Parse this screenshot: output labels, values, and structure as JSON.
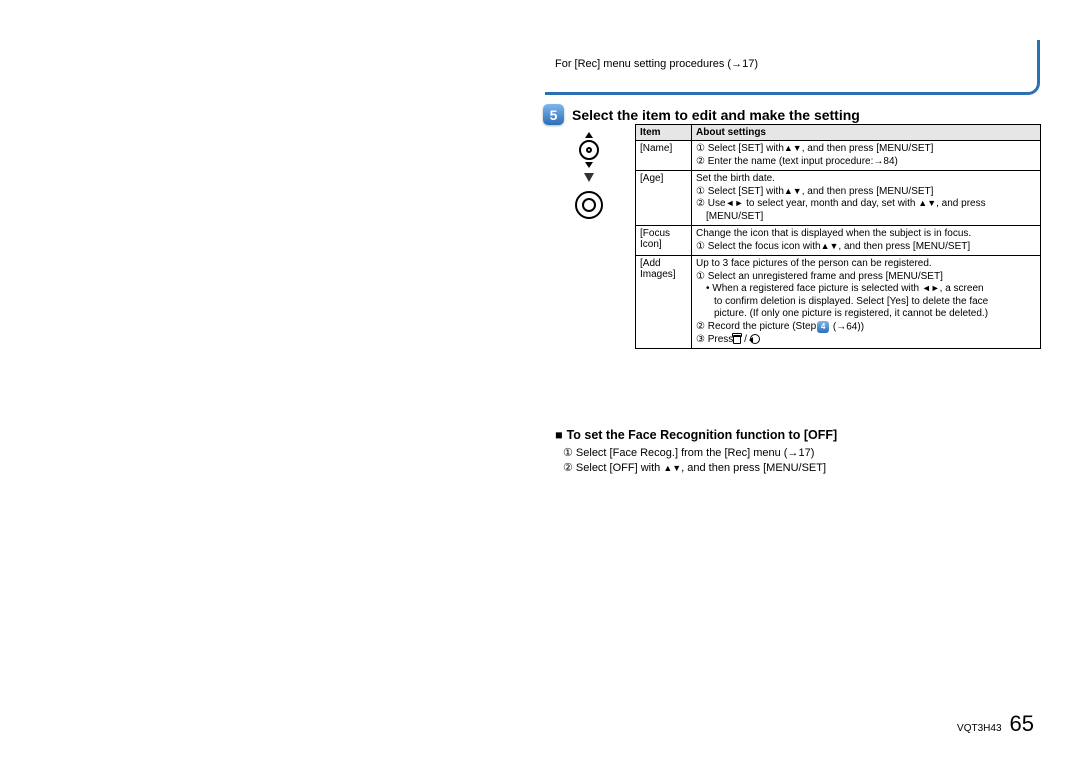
{
  "topNote": {
    "prefix": "For [Rec] menu setting procedures (",
    "ref": "→17",
    "suffix": ")"
  },
  "step": {
    "number": "5",
    "title": "Select the item to edit and make the setting"
  },
  "table": {
    "headers": {
      "item": "Item",
      "about": "About settings"
    },
    "rows": {
      "name": {
        "item": "[Name]",
        "l1a": "① Select [SET] with ",
        "l1b": ", and then press [MENU/SET]",
        "l2a": "② Enter the name (text input procedure: ",
        "l2ref": "→84",
        "l2b": ")"
      },
      "age": {
        "item": "[Age]",
        "l0": "Set the birth date.",
        "l1a": "① Select [SET] with ",
        "l1b": ", and then press [MENU/SET]",
        "l2a": "② Use ",
        "l2b": " to select year, month and day, set with ",
        "l2c": ", and press",
        "l3": "[MENU/SET]"
      },
      "focus": {
        "item1": "[Focus",
        "item2": "Icon]",
        "l0": "Change the icon that is displayed when the subject is in focus.",
        "l1a": "① Select the focus icon with ",
        "l1b": ", and then press [MENU/SET]"
      },
      "add": {
        "item1": "[Add",
        "item2": "Images]",
        "l0": "Up to 3 face pictures of the person can be registered.",
        "l1": "① Select an unregistered frame and press [MENU/SET]",
        "b1a": "• When a registered face picture is selected with ",
        "b1b": ", a screen",
        "b2": "to confirm deletion is displayed. Select [Yes] to delete the face",
        "b3": "picture. (If only one picture is registered, it cannot be deleted.)",
        "l2a": "② Record the picture (Step ",
        "l2num": "4",
        "l2b": " (",
        "l2ref": "→64",
        "l2c": "))",
        "l3a": "③ Press ",
        "l3b": " / "
      }
    }
  },
  "sub": {
    "heading": "To set the Face Recognition function to [OFF]",
    "l1a": "① Select [Face Recog.] from the [Rec] menu (",
    "l1ref": "→17",
    "l1b": ")",
    "l2a": "② Select [OFF] with ",
    "l2b": ", and then press [MENU/SET]"
  },
  "footer": {
    "code": "VQT3H43",
    "page": "65"
  }
}
